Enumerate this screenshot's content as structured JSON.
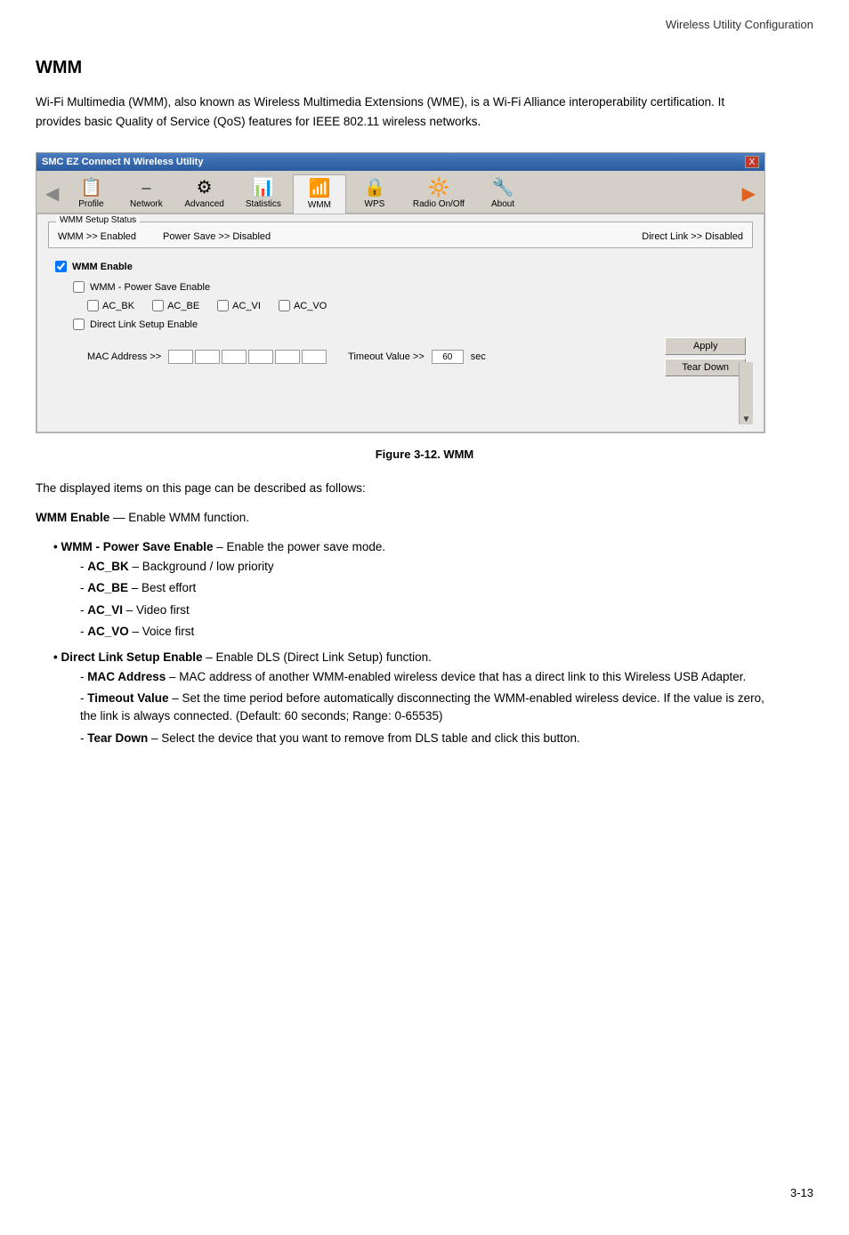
{
  "header": {
    "title": "Wireless Utility Configuration"
  },
  "section": {
    "title": "WMM",
    "intro": "Wi-Fi Multimedia (WMM), also known as Wireless Multimedia Extensions (WME), is a Wi-Fi Alliance interoperability certification. It provides basic Quality of Service (QoS) features for IEEE 802.11 wireless networks."
  },
  "app": {
    "titlebar": "SMC EZ Connect N Wireless Utility",
    "close_label": "X",
    "nav_back_icon": "◄",
    "nav_fwd_icon": "►"
  },
  "tabs": [
    {
      "id": "profile",
      "label": "Profile",
      "icon": "📋",
      "active": false
    },
    {
      "id": "network",
      "label": "Network",
      "icon": "🔌",
      "active": false
    },
    {
      "id": "advanced",
      "label": "Advanced",
      "icon": "⚙",
      "active": false
    },
    {
      "id": "statistics",
      "label": "Statistics",
      "icon": "📊",
      "active": false
    },
    {
      "id": "wmm",
      "label": "WMM",
      "icon": "📶",
      "active": true
    },
    {
      "id": "wps",
      "label": "WPS",
      "icon": "🔒",
      "active": false
    },
    {
      "id": "radioOnOff",
      "label": "Radio On/Off",
      "icon": "🔆",
      "active": false
    },
    {
      "id": "about",
      "label": "About",
      "icon": "🔧",
      "active": false
    }
  ],
  "status": {
    "group_label": "WMM Setup Status",
    "wmm_status": "WMM >> Enabled",
    "power_save_status": "Power Save >> Disabled",
    "direct_link_status": "Direct Link >> Disabled"
  },
  "form": {
    "wmm_enable_label": "WMM Enable",
    "wmm_power_save_label": "WMM - Power Save Enable",
    "ac_bk_label": "AC_BK",
    "ac_be_label": "AC_BE",
    "ac_vi_label": "AC_VI",
    "ac_vo_label": "AC_VO",
    "direct_link_label": "Direct Link Setup Enable",
    "mac_address_label": "MAC Address >>",
    "timeout_label": "Timeout Value >>",
    "timeout_value": "60",
    "timeout_unit": "sec",
    "apply_label": "Apply",
    "teardown_label": "Tear Down"
  },
  "figure": {
    "caption": "Figure 3-12.  WMM"
  },
  "description": {
    "displayed_items": "The displayed items on this page can be described as follows:",
    "wmm_enable_title": "WMM Enable",
    "wmm_enable_desc": "— Enable WMM function.",
    "bullets": [
      {
        "title": "WMM - Power Save Enable",
        "desc": " – Enable the power save mode.",
        "subs": [
          {
            "title": "AC_BK",
            "desc": " – Background / low priority"
          },
          {
            "title": "AC_BE",
            "desc": " – Best effort"
          },
          {
            "title": "AC_VI",
            "desc": " – Video first"
          },
          {
            "title": "AC_VO",
            "desc": " – Voice first"
          }
        ]
      },
      {
        "title": "Direct Link Setup Enable",
        "desc": " – Enable DLS (Direct Link Setup) function.",
        "subs": [
          {
            "title": "MAC Address",
            "desc": " – MAC address of another WMM-enabled wireless device that has a direct link to this Wireless USB Adapter."
          },
          {
            "title": "Timeout Value",
            "desc": " – Set the time period before automatically disconnecting the WMM-enabled wireless device. If the value is zero, the link is always connected. (Default: 60 seconds; Range: 0-65535)"
          },
          {
            "title": "Tear Down",
            "desc": " – Select the device that you want to remove from DLS table and click this button."
          }
        ]
      }
    ]
  },
  "page_number": "3-13"
}
